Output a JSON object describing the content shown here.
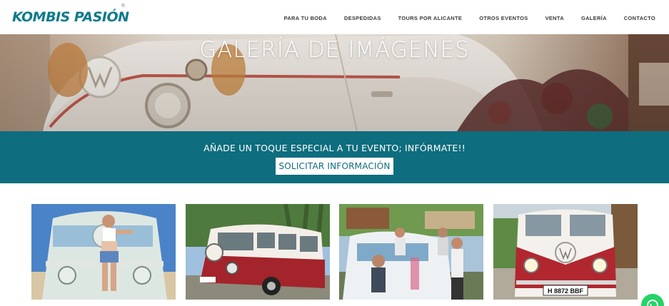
{
  "brand": {
    "word_left": "KOMBIS",
    "word_right": "PASIÓN",
    "registered": "®",
    "primary_color": "#0f7a8c",
    "accent_color": "#f39a1e"
  },
  "nav": {
    "items": [
      {
        "label": "PARA TU BODA"
      },
      {
        "label": "DESPEDIDAS"
      },
      {
        "label": "TOURS POR ALICANTE"
      },
      {
        "label": "OTROS EVENTOS"
      },
      {
        "label": "VENTA"
      },
      {
        "label": "GALERÍA"
      },
      {
        "label": "CONTACTO"
      }
    ]
  },
  "hero": {
    "title": "GALERÍA DE IMÁGENES"
  },
  "cta": {
    "text": "AÑADE UN TOQUE ESPECIAL A TU EVENTO; INFÓRMATE!!",
    "button_label": "SOLICITAR INFORMACIÓN",
    "band_color": "#0e6d7e"
  },
  "gallery": {
    "thumbs": [
      {
        "name": "photo-woman-with-kombi"
      },
      {
        "name": "photo-red-kombi-palms"
      },
      {
        "name": "photo-kombi-event-guests"
      },
      {
        "name": "photo-red-kombi-front",
        "plate": "H 8872 BBF"
      }
    ]
  },
  "whatsapp": {
    "icon": "whatsapp-icon",
    "color": "#25d366"
  }
}
